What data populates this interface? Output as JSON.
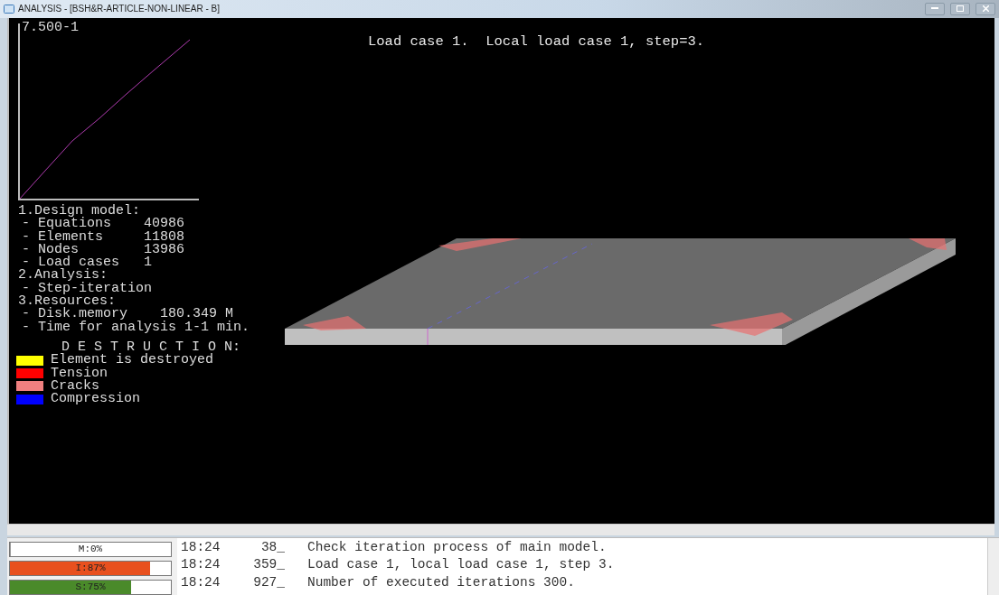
{
  "window": {
    "title": "ANALYSIS - [BSH&R-ARTICLE-NON-LINEAR - B]"
  },
  "viewport": {
    "header": "Load case 1.  Local load case 1, step=3.",
    "graph_label": "7.500-1",
    "info_sections": [
      {
        "title": "1.Design model:",
        "children": [
          "- Equations    40986",
          "- Elements     11808",
          "- Nodes        13986",
          "- Load cases   1"
        ]
      },
      {
        "title": "2.Analysis:",
        "children": [
          "- Step-iteration"
        ]
      },
      {
        "title": "3.Resources:",
        "children": [
          "- Disk.memory    180.349 M",
          "- Time for analysis 1-1 min."
        ]
      }
    ],
    "legend": {
      "title": "D E S T R U C T I O N:",
      "items": [
        {
          "label": "Element is destroyed",
          "color": "#ffff00"
        },
        {
          "label": "Tension",
          "color": "#ff0000"
        },
        {
          "label": "Cracks",
          "color": "#f08080"
        },
        {
          "label": "Compression",
          "color": "#0000ff"
        }
      ]
    }
  },
  "progress": [
    {
      "label": "M:0%",
      "level": 0
    },
    {
      "label": "I:87%",
      "level": 0.87,
      "color": "#e8501e"
    },
    {
      "label": "S:75%",
      "level": 0.75,
      "color": "#4a8a2a"
    }
  ],
  "log": [
    {
      "time": "18:24",
      "count": "38_",
      "message": "Check iteration process of main model."
    },
    {
      "time": "18:24",
      "count": "359_",
      "message": "Load case 1, local load case 1, step 3."
    },
    {
      "time": "18:24",
      "count": "927_",
      "message": "Number of executed iterations 300."
    }
  ]
}
